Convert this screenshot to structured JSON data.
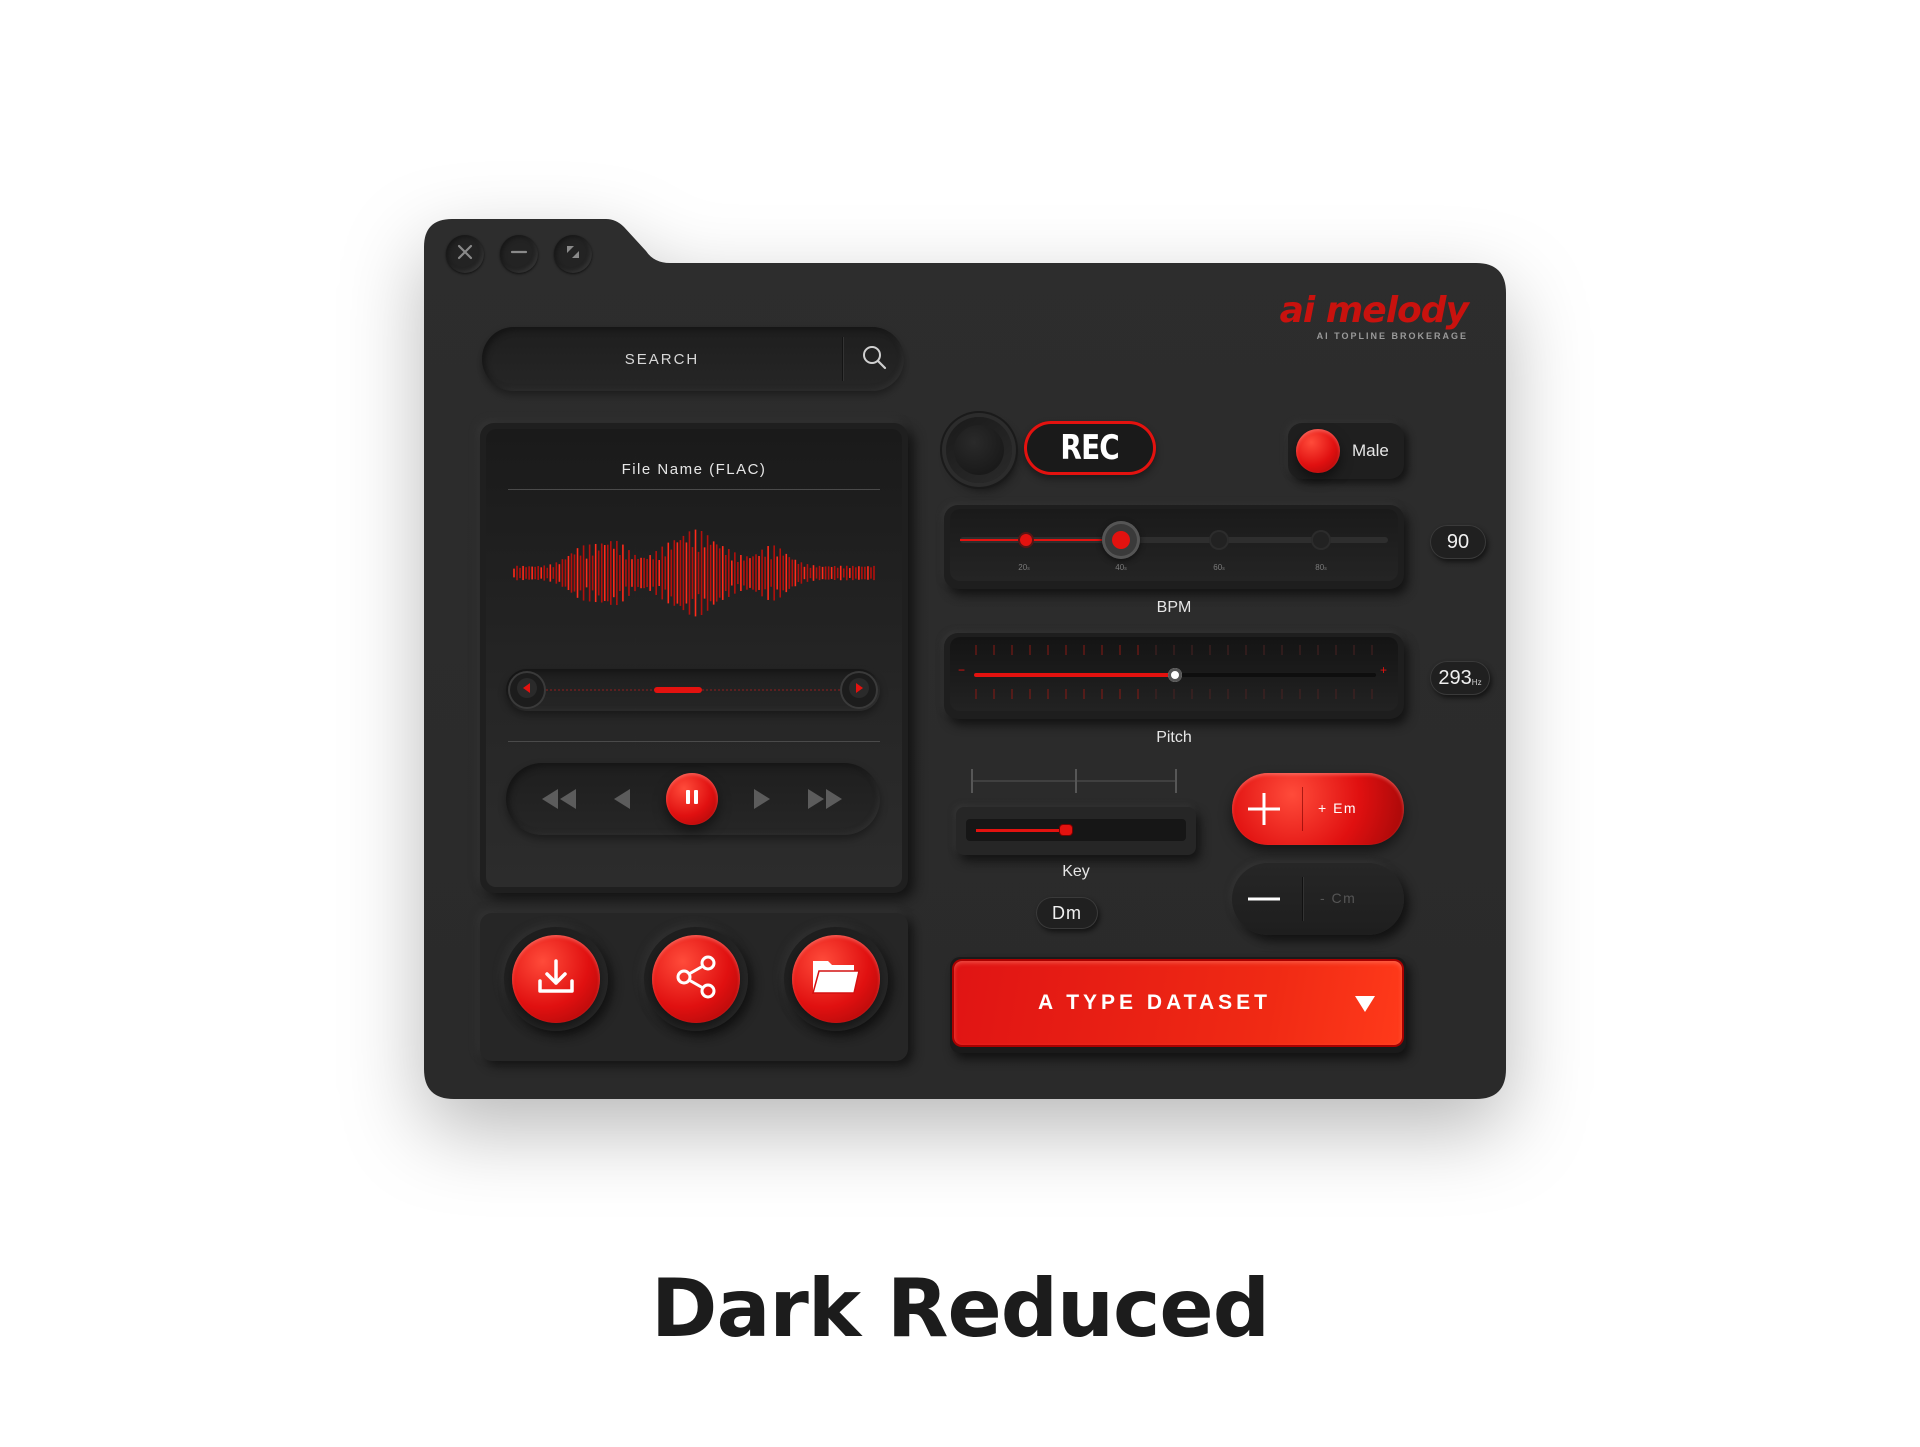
{
  "window": {
    "controls": [
      "close-icon",
      "minimize-icon",
      "maximize-icon"
    ]
  },
  "brand": {
    "logo_text": "AI melody",
    "tagline": "AI TOPLINE BROKERAGE",
    "accent": "#e3120f"
  },
  "search": {
    "placeholder": "SEARCH"
  },
  "player": {
    "file_name": "File Name (FLAC)",
    "progress_fraction": 0.45,
    "transport": [
      "rewind-icon",
      "previous-icon",
      "pause-icon",
      "next-icon",
      "fast-forward-icon"
    ]
  },
  "record": {
    "label": "REC"
  },
  "voice": {
    "label": "Male"
  },
  "bpm": {
    "label": "BPM",
    "value": "90",
    "ticks": [
      "20",
      "40",
      "60",
      "80"
    ],
    "tick_unit": "s"
  },
  "pitch": {
    "label": "Pitch",
    "value": "293",
    "unit": "Hz",
    "minus": "−",
    "plus": "+",
    "fraction": 0.5
  },
  "key": {
    "label": "Key",
    "value": "Dm",
    "fraction": 0.45
  },
  "chord_buttons": {
    "add_label": "+ Em",
    "remove_label": "- Cm"
  },
  "dataset": {
    "label": "A TYPE DATASET"
  },
  "actions": [
    "download-icon",
    "share-icon",
    "folder-icon"
  ],
  "caption": "Dark Reduced"
}
